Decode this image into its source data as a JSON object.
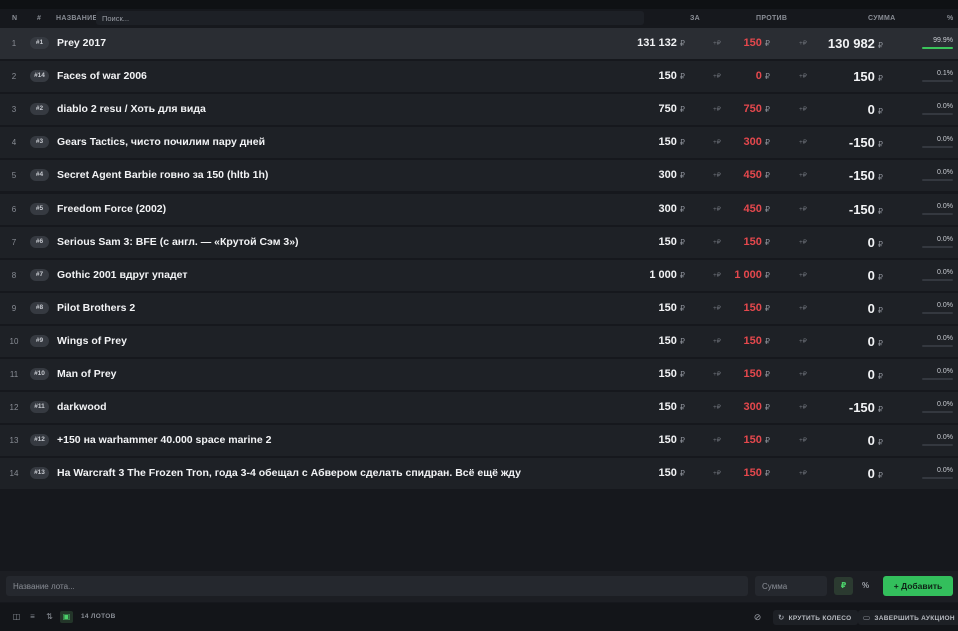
{
  "header": {
    "col_n": "N",
    "col_hash": "#",
    "col_name": "НАЗВАНИЕ",
    "search_placeholder": "Поиск...",
    "col_for": "ЗА",
    "col_against": "ПРОТИВ",
    "col_sum": "СУММА",
    "col_pct": "%"
  },
  "currency": "₽",
  "add_label": "+₽",
  "lots": [
    {
      "n": "1",
      "badge": "#1",
      "name": "Prey 2017",
      "for": "131 132",
      "against": "150",
      "sum": "130 982",
      "pct_label": "99.9%",
      "pct": 99.9
    },
    {
      "n": "2",
      "badge": "#14",
      "name": "Faces of war 2006",
      "for": "150",
      "against": "0",
      "sum": "150",
      "pct_label": "0.1%",
      "pct": 0.1
    },
    {
      "n": "3",
      "badge": "#2",
      "name": "diablo 2 resu / Хоть для вида",
      "for": "750",
      "against": "750",
      "sum": "0",
      "pct_label": "0.0%",
      "pct": 0
    },
    {
      "n": "4",
      "badge": "#3",
      "name": "Gears Tactics, чисто почилим пару дней",
      "for": "150",
      "against": "300",
      "sum": "-150",
      "pct_label": "0.0%",
      "pct": 0
    },
    {
      "n": "5",
      "badge": "#4",
      "name": "Secret Agent Barbie говно за 150 (hltb 1h)",
      "for": "300",
      "against": "450",
      "sum": "-150",
      "pct_label": "0.0%",
      "pct": 0
    },
    {
      "n": "6",
      "badge": "#5",
      "name": "Freedom Force (2002)",
      "for": "300",
      "against": "450",
      "sum": "-150",
      "pct_label": "0.0%",
      "pct": 0
    },
    {
      "n": "7",
      "badge": "#6",
      "name": "Serious Sam 3: BFE (с англ. — «Крутой Сэм 3»)",
      "for": "150",
      "against": "150",
      "sum": "0",
      "pct_label": "0.0%",
      "pct": 0
    },
    {
      "n": "8",
      "badge": "#7",
      "name": "Gothic 2001 вдруг упадет",
      "for": "1 000",
      "against": "1 000",
      "sum": "0",
      "pct_label": "0.0%",
      "pct": 0
    },
    {
      "n": "9",
      "badge": "#8",
      "name": "Pilot Brothers 2",
      "for": "150",
      "against": "150",
      "sum": "0",
      "pct_label": "0.0%",
      "pct": 0
    },
    {
      "n": "10",
      "badge": "#9",
      "name": "Wings of Prey",
      "for": "150",
      "against": "150",
      "sum": "0",
      "pct_label": "0.0%",
      "pct": 0
    },
    {
      "n": "11",
      "badge": "#10",
      "name": "Man of Prey",
      "for": "150",
      "against": "150",
      "sum": "0",
      "pct_label": "0.0%",
      "pct": 0
    },
    {
      "n": "12",
      "badge": "#11",
      "name": "darkwood",
      "for": "150",
      "against": "300",
      "sum": "-150",
      "pct_label": "0.0%",
      "pct": 0
    },
    {
      "n": "13",
      "badge": "#12",
      "name": "+150 на warhammer 40.000 space marine 2",
      "for": "150",
      "against": "150",
      "sum": "0",
      "pct_label": "0.0%",
      "pct": 0
    },
    {
      "n": "14",
      "badge": "#13",
      "name": "На Warcraft 3 The Frozen Tron, года 3-4 обещал с Абвером сделать спидран. Всё ещё жду",
      "for": "150",
      "against": "150",
      "sum": "0",
      "pct_label": "0.0%",
      "pct": 0
    }
  ],
  "input_bar": {
    "lot_placeholder": "Название лота...",
    "sum_placeholder": "Сумма",
    "currency_rub": "₽",
    "currency_pct": "%",
    "add_button": "+ Добавить"
  },
  "footer": {
    "lots_count": "14 ЛОТОВ",
    "spin_wheel": "КРУТИТЬ КОЛЕСО",
    "finish_auction": "ЗАВЕРШИТЬ АУКЦИОН"
  },
  "colors": {
    "accent_green": "#33bf5c",
    "against_red": "#e5484d",
    "row_bg": "#1e2126",
    "page_bg": "#16181d"
  }
}
